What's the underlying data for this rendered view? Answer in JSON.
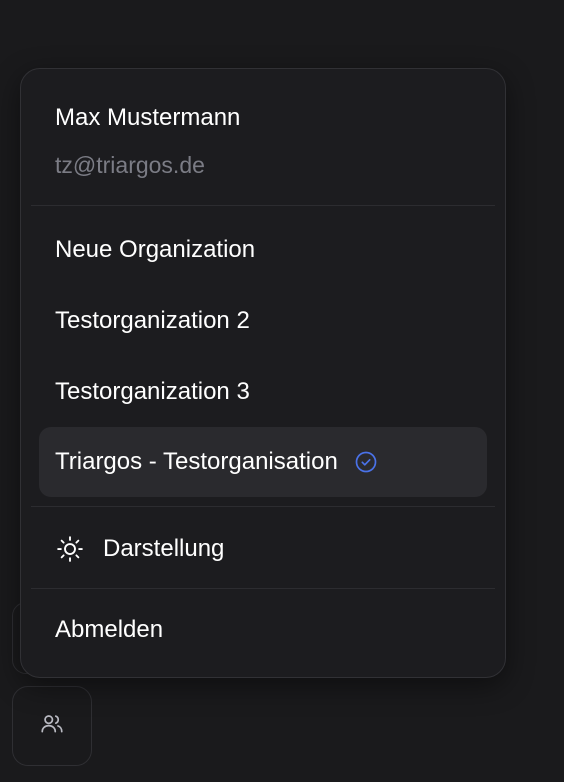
{
  "user": {
    "name": "Max Mustermann",
    "email": "tz@triargos.de"
  },
  "organizations": [
    {
      "label": "Neue Organization",
      "active": false
    },
    {
      "label": "Testorganization 2",
      "active": false
    },
    {
      "label": "Testorganization 3",
      "active": false
    },
    {
      "label": "Triargos - Testorganisation",
      "active": true
    }
  ],
  "appearance": {
    "label": "Darstellung",
    "icon": "sun-icon"
  },
  "logout": {
    "label": "Abmelden"
  },
  "bottom_button": {
    "icon": "users-icon"
  },
  "colors": {
    "background": "#1a1a1c",
    "menu_background": "#1c1c1f",
    "active_item": "#2a2a2e",
    "muted_text": "#7b7c85",
    "accent_check": "#4a72e8"
  }
}
